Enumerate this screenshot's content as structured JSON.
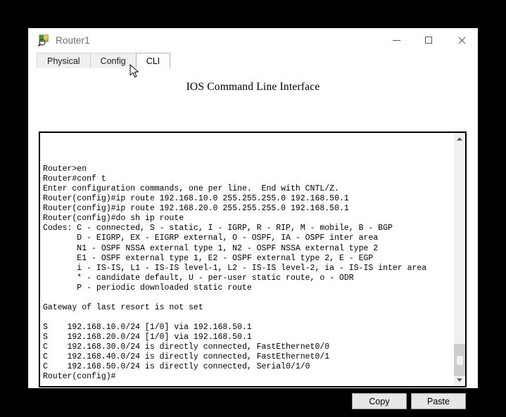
{
  "window": {
    "title": "Router1",
    "icon": "router-device-icon",
    "controls": {
      "minimize": "minimize-icon",
      "maximize": "maximize-icon",
      "close": "close-icon"
    }
  },
  "tabs": [
    {
      "label": "Physical",
      "active": false
    },
    {
      "label": "Config",
      "active": false
    },
    {
      "label": "CLI",
      "active": true
    }
  ],
  "panel": {
    "title": "IOS Command Line Interface"
  },
  "terminal": {
    "lines": [
      "",
      "",
      "",
      "Router>en",
      "Router#conf t",
      "Enter configuration commands, one per line.  End with CNTL/Z.",
      "Router(config)#ip route 192.168.10.0 255.255.255.0 192.168.50.1",
      "Router(config)#ip route 192.168.20.0 255.255.255.0 192.168.50.1",
      "Router(config)#do sh ip route",
      "Codes: C - connected, S - static, I - IGRP, R - RIP, M - mobile, B - BGP",
      "       D - EIGRP, EX - EIGRP external, O - OSPF, IA - OSPF inter area",
      "       N1 - OSPF NSSA external type 1, N2 - OSPF NSSA external type 2",
      "       E1 - OSPF external type 1, E2 - OSPF external type 2, E - EGP",
      "       i - IS-IS, L1 - IS-IS level-1, L2 - IS-IS level-2, ia - IS-IS inter area",
      "       * - candidate default, U - per-user static route, o - ODR",
      "       P - periodic downloaded static route",
      "",
      "Gateway of last resort is not set",
      "",
      "S    192.168.10.0/24 [1/0] via 192.168.50.1",
      "S    192.168.20.0/24 [1/0] via 192.168.50.1",
      "C    192.168.30.0/24 is directly connected, FastEthernet0/0",
      "C    192.168.40.0/24 is directly connected, FastEthernet0/1",
      "C    192.168.50.0/24 is directly connected, Serial0/1/0",
      "Router(config)#"
    ],
    "routing_table": [
      {
        "code": "S",
        "network": "192.168.10.0/24",
        "metric": "[1/0]",
        "description": "via 192.168.50.1"
      },
      {
        "code": "S",
        "network": "192.168.20.0/24",
        "metric": "[1/0]",
        "description": "via 192.168.50.1"
      },
      {
        "code": "C",
        "network": "192.168.30.0/24",
        "metric": "",
        "description": "is directly connected, FastEthernet0/0"
      },
      {
        "code": "C",
        "network": "192.168.40.0/24",
        "metric": "",
        "description": "is directly connected, FastEthernet0/1"
      },
      {
        "code": "C",
        "network": "192.168.50.0/24",
        "metric": "",
        "description": "is directly connected, Serial0/1/0"
      }
    ],
    "gateway_status": "Gateway of last resort is not set",
    "prompt": "Router(config)#"
  },
  "scrollbar": {
    "up_arrow": "chevron-up-icon",
    "down_arrow": "chevron-down-icon"
  },
  "buttons": {
    "copy": "Copy",
    "paste": "Paste"
  },
  "colors": {
    "desktop": "#000000",
    "window_bg": "#ffffff",
    "tab_inactive": "#f0f0f0",
    "terminal_text": "#000000",
    "button_face": "#e6e6e6",
    "scrollbar_track": "#f0f0f0",
    "scrollbar_thumb": "#cdcdcd"
  }
}
